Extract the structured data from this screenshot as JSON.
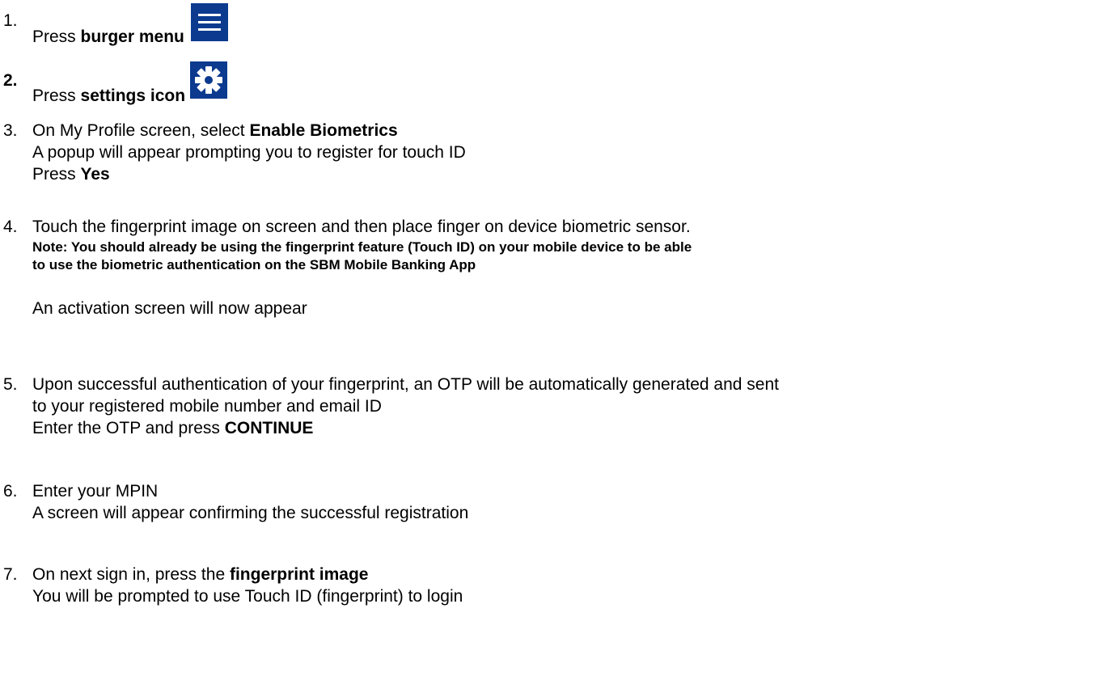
{
  "steps": [
    {
      "number": "1.",
      "parts": [
        "Press ",
        "burger menu"
      ]
    },
    {
      "number": "2.",
      "parts": [
        "Press ",
        "settings icon"
      ]
    },
    {
      "number": "3.",
      "lines": [
        {
          "text": "On My Profile screen, select ",
          "bold": "Enable Biometrics"
        },
        {
          "text": "A popup will appear prompting you to register for touch ID"
        },
        {
          "text": "Press ",
          "bold": "Yes"
        }
      ]
    },
    {
      "number": "4.",
      "lines": [
        {
          "text": "Touch the fingerprint image on screen and then place finger on device biometric sensor."
        }
      ],
      "note_lines": [
        "Note: You should already be using the fingerprint feature (Touch ID) on your mobile device to be able",
        "to use the biometric authentication on the SBM Mobile Banking App"
      ],
      "followup": "An activation screen will now appear"
    },
    {
      "number": "5.",
      "lines": [
        {
          "text": "Upon successful authentication of your fingerprint, an OTP will be automatically generated and sent"
        },
        {
          "text": "to your registered mobile number and email ID"
        },
        {
          "text": "Enter the OTP and press ",
          "bold": "CONTINUE"
        }
      ]
    },
    {
      "number": "6.",
      "lines": [
        {
          "text": "Enter your MPIN"
        },
        {
          "text": "A screen will appear confirming the successful registration"
        }
      ]
    },
    {
      "number": "7.",
      "lines": [
        {
          "text": "On next sign in, press the ",
          "bold": "fingerprint image"
        },
        {
          "text": "You will be prompted to use Touch ID (fingerprint) to login"
        }
      ]
    }
  ],
  "icons": {
    "burger": "burger-menu-icon",
    "settings": "gear-icon"
  },
  "colors": {
    "icon_background": "#0b3a8f",
    "icon_foreground": "#ffffff",
    "text": "#000000"
  }
}
